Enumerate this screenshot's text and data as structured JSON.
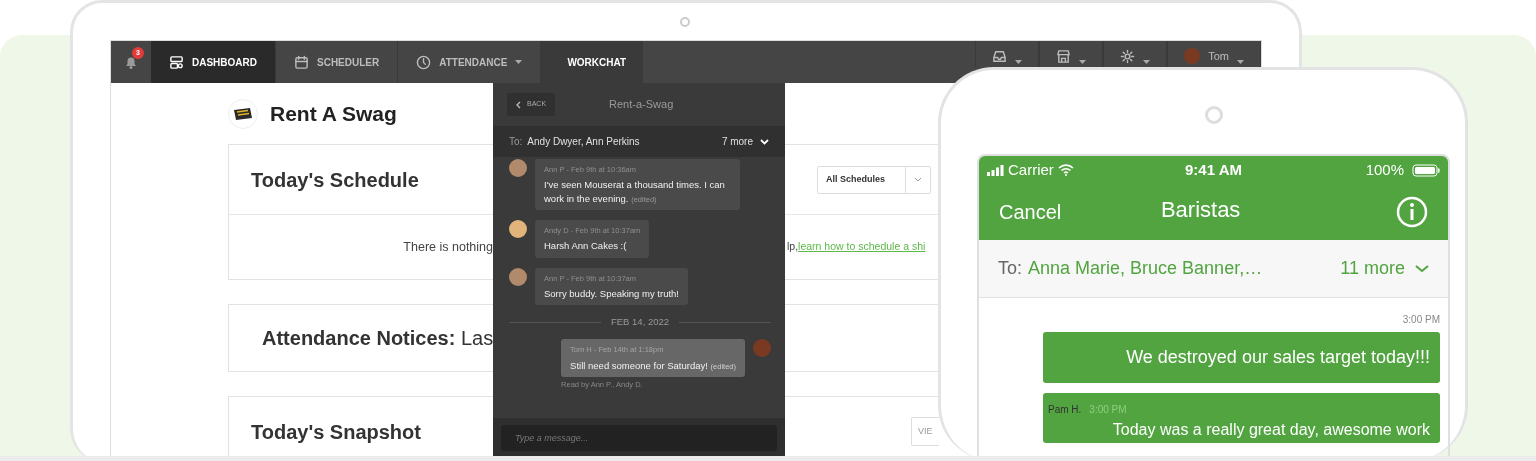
{
  "laptop": {
    "navbar": {
      "notifications": {
        "count": "3"
      },
      "tabs": [
        {
          "label": "DASHBOARD",
          "selected": true,
          "expanded": false,
          "dropdown": false
        },
        {
          "label": "SCHEDULER",
          "selected": false,
          "expanded": false,
          "dropdown": false
        },
        {
          "label": "ATTENDANCE",
          "selected": false,
          "expanded": false,
          "dropdown": true
        },
        {
          "label": "WORKCHAT",
          "selected": false,
          "expanded": true,
          "dropdown": false
        }
      ],
      "menus": [
        {
          "kind": "icon"
        },
        {
          "kind": "icon"
        },
        {
          "kind": "icon"
        },
        {
          "kind": "user",
          "label": "Tom"
        }
      ]
    },
    "company": {
      "name": "Rent A Swag"
    },
    "cards": [
      {
        "kind": "schedule",
        "title": "Today's Schedule",
        "dropdown": "All Schedules",
        "body_left": "There is nothing",
        "body_right": "lp,",
        "link": "learn how to schedule a shi"
      },
      {
        "kind": "notices",
        "title": "**Attendance Notices:** Las"
      },
      {
        "kind": "snapshot",
        "title": "Today's Snapshot",
        "button": "VIE"
      }
    ],
    "chat": {
      "back": "BACK",
      "title": "Rent-a-Swag",
      "to_label": "To:",
      "recipients": "Andy Dwyer, Ann Perkins",
      "more": "7 more",
      "messages": [
        {
          "kind": "message",
          "own": false,
          "meta": "Ann P - Feb 9th at 10:36am",
          "text": "I've seen Mouserat a thousand times. I can work in the evening.",
          "note": "(edited)",
          "color": "#b08a6a"
        },
        {
          "kind": "message",
          "own": false,
          "meta": "Andy D - Feb 9th at 10:37am",
          "text": "Harsh Ann Cakes :(",
          "color": "#e0b47a"
        },
        {
          "kind": "message",
          "own": false,
          "meta": "Ann P - Feb 9th at 10:37am",
          "text": "Sorry buddy. Speaking my truth!",
          "color": "#b08a6a"
        },
        {
          "kind": "divider",
          "text": "FEB 14, 2022"
        },
        {
          "kind": "message",
          "own": true,
          "meta": "Tom H - Feb 14th at 1:18pm",
          "text": "Still need someone for Saturday!",
          "note": "(edited)",
          "read": "Read by Ann P., Andy D.",
          "color": "#7a3a22"
        }
      ],
      "input": {
        "placeholder": "Type a message..."
      }
    }
  },
  "phone": {
    "status_bar": {
      "carrier": "Carrier",
      "time": "9:41 AM",
      "battery": "100%"
    },
    "header": {
      "cancel": "Cancel",
      "title": "Baristas"
    },
    "to_row": {
      "label": "To:",
      "recipients": "Anna Marie, Bruce Banner,…",
      "more": "11 more"
    },
    "messages": [
      {
        "kind": "time",
        "text": "3:00 PM"
      },
      {
        "kind": "bubble",
        "text": "We destroyed our sales target today!!!"
      },
      {
        "kind": "incoming",
        "sender": "Pam H.",
        "time": "3:00 PM",
        "text": "Today was a really great day, awesome work"
      }
    ]
  }
}
